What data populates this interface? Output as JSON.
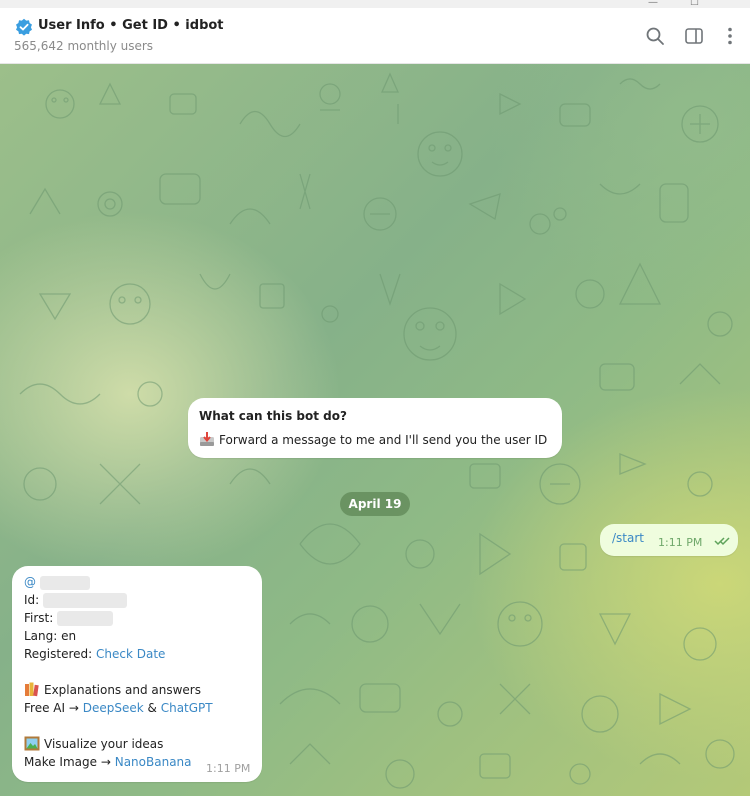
{
  "header": {
    "title": "User Info • Get ID • idbot",
    "subtitle": "565,642 monthly users"
  },
  "intro": {
    "heading": "What can this bot do?",
    "text": "Forward a message to me and I'll send you the user ID"
  },
  "date_separator": "April 19",
  "outgoing": {
    "text": "/start",
    "time": "1:11 PM"
  },
  "incoming": {
    "at": "@",
    "id_label": "Id:",
    "first_label": "First:",
    "lang": "Lang: en",
    "registered_label": "Registered:",
    "check_date": "Check Date",
    "explanations": "Explanations and answers",
    "free_ai": "Free AI →",
    "deepseek": "DeepSeek",
    "amp": "&",
    "chatgpt": "ChatGPT",
    "visualize": "Visualize your ideas",
    "make_image": "Make Image →",
    "nanobanana": "NanoBanana",
    "time": "1:11 PM"
  },
  "colors": {
    "link": "#3a88c5",
    "outgoing_bubble": "#effdde",
    "date_pill": "#5f8755"
  }
}
